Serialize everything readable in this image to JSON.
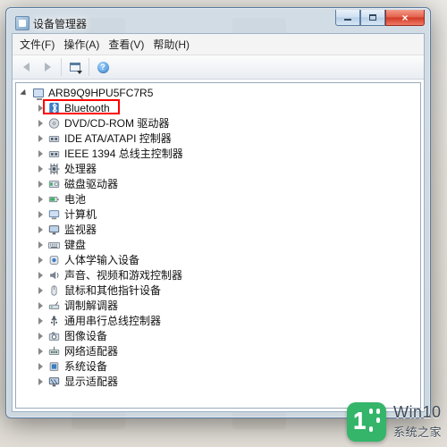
{
  "window": {
    "title": "设备管理器"
  },
  "menu": {
    "file": "文件(F)",
    "action": "操作(A)",
    "view": "查看(V)",
    "help": "帮助(H)"
  },
  "toolbar": {
    "back": "back",
    "forward": "forward",
    "props": "properties",
    "helpBtn": "help"
  },
  "tree": {
    "root": "ARB9Q9HPU5FC7R5",
    "items": [
      {
        "label": "Bluetooth",
        "icon": "bluetooth",
        "highlighted": true
      },
      {
        "label": "DVD/CD-ROM 驱动器",
        "icon": "disc"
      },
      {
        "label": "IDE ATA/ATAPI 控制器",
        "icon": "controller"
      },
      {
        "label": "IEEE 1394 总线主控制器",
        "icon": "controller"
      },
      {
        "label": "处理器",
        "icon": "cpu"
      },
      {
        "label": "磁盘驱动器",
        "icon": "disk"
      },
      {
        "label": "电池",
        "icon": "battery"
      },
      {
        "label": "计算机",
        "icon": "computer"
      },
      {
        "label": "监视器",
        "icon": "monitor"
      },
      {
        "label": "键盘",
        "icon": "keyboard"
      },
      {
        "label": "人体学输入设备",
        "icon": "hid"
      },
      {
        "label": "声音、视频和游戏控制器",
        "icon": "sound"
      },
      {
        "label": "鼠标和其他指针设备",
        "icon": "mouse"
      },
      {
        "label": "调制解调器",
        "icon": "modem"
      },
      {
        "label": "通用串行总线控制器",
        "icon": "usb"
      },
      {
        "label": "图像设备",
        "icon": "imaging"
      },
      {
        "label": "网络适配器",
        "icon": "network"
      },
      {
        "label": "系统设备",
        "icon": "system"
      },
      {
        "label": "显示适配器",
        "icon": "display"
      }
    ]
  },
  "footer": {
    "brand_main": "Win10",
    "brand_sub": "系统之家"
  }
}
